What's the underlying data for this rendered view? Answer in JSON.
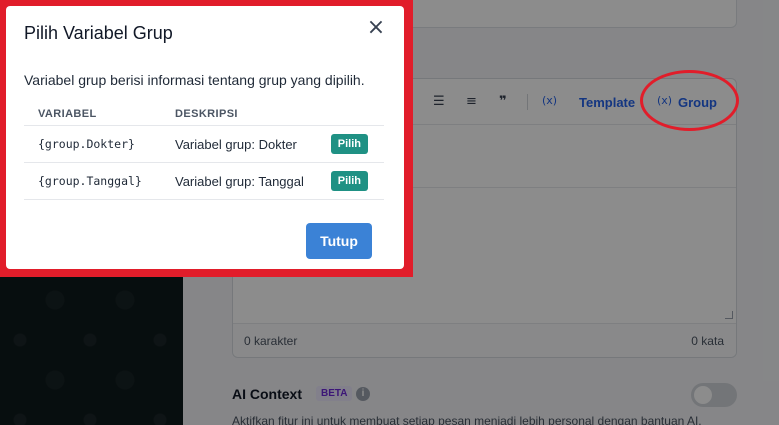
{
  "modal": {
    "title": "Pilih Variabel Grup",
    "close_icon": "close-icon",
    "description": "Variabel grup berisi informasi tentang grup yang dipilih.",
    "columns": [
      "VARIABEL",
      "DESKRIPSI"
    ],
    "rows": [
      {
        "variable": "{group.Dokter}",
        "description": "Variabel grup: Dokter",
        "action": "Pilih"
      },
      {
        "variable": "{group.Tanggal}",
        "description": "Variabel grup: Tanggal",
        "action": "Pilih"
      }
    ],
    "footer_button": "Tutup"
  },
  "editor": {
    "toolbar": {
      "icons": [
        "bulleted-list-icon",
        "numbered-list-icon",
        "quote-icon",
        "variable-icon"
      ],
      "template_label": "Template",
      "group_label": "Group"
    },
    "char_count": "0 karakter",
    "word_count": "0 kata"
  },
  "ai_context": {
    "title": "AI Context",
    "badge": "BETA",
    "enabled": false,
    "description": "Aktifkan fitur ini untuk membuat setiap pesan menjadi lebih personal dengan bantuan AI."
  },
  "colors": {
    "annotation_red": "#e11d2a",
    "pick_button": "#1f9184",
    "primary_button": "#3b82d6",
    "link_blue": "#2563eb"
  }
}
